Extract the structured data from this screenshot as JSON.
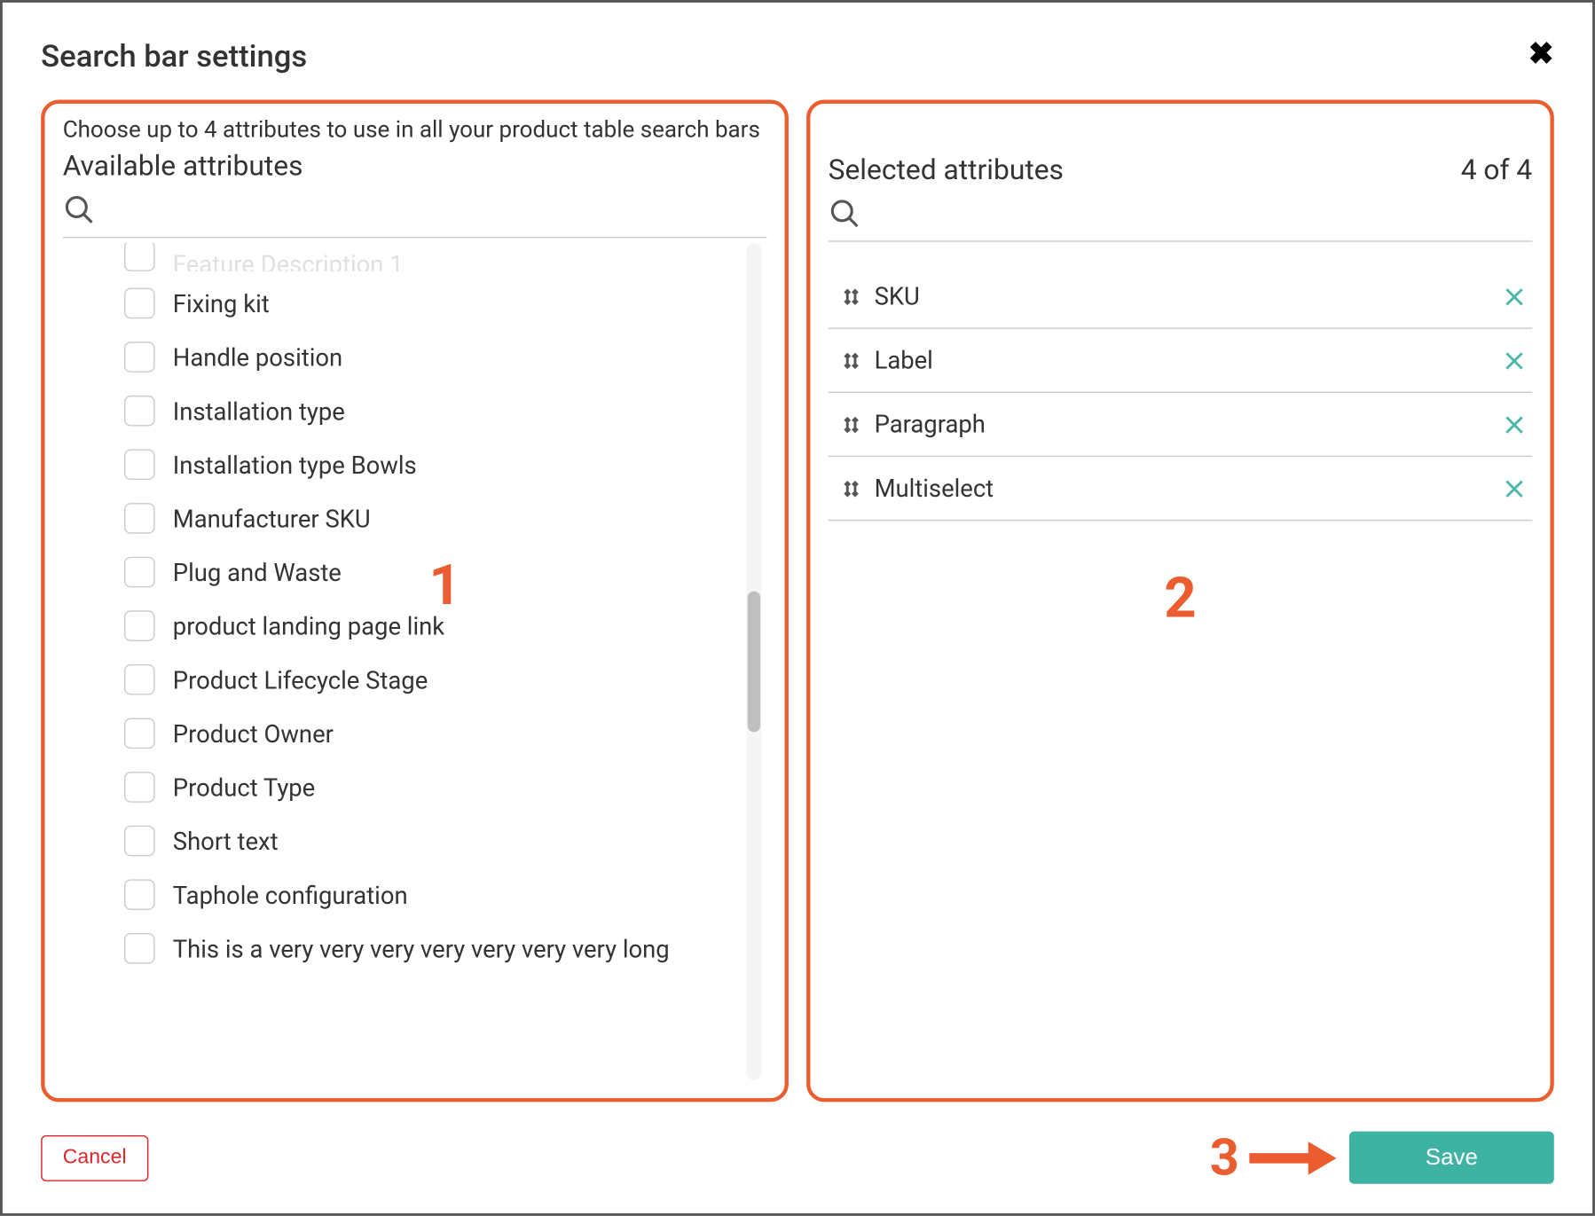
{
  "header": {
    "title": "Search bar settings"
  },
  "left_panel": {
    "instruction": "Choose up to 4 attributes to use in all your product table search bars",
    "title": "Available attributes",
    "search_value": "",
    "truncated_first": "Feature Description 1",
    "items": [
      "Fixing kit",
      "Handle position",
      "Installation type",
      "Installation type Bowls",
      "Manufacturer SKU",
      "Plug and Waste",
      "product landing page link",
      "Product Lifecycle Stage",
      "Product Owner",
      "Product Type",
      "Short text",
      "Taphole configuration",
      "This is a very very very very very very very long"
    ]
  },
  "right_panel": {
    "title": "Selected attributes",
    "count": "4 of 4",
    "search_value": "",
    "items": [
      "SKU",
      "Label",
      "Paragraph",
      "Multiselect"
    ]
  },
  "annotations": {
    "one": "1",
    "two": "2",
    "three": "3"
  },
  "footer": {
    "cancel": "Cancel",
    "save": "Save"
  }
}
